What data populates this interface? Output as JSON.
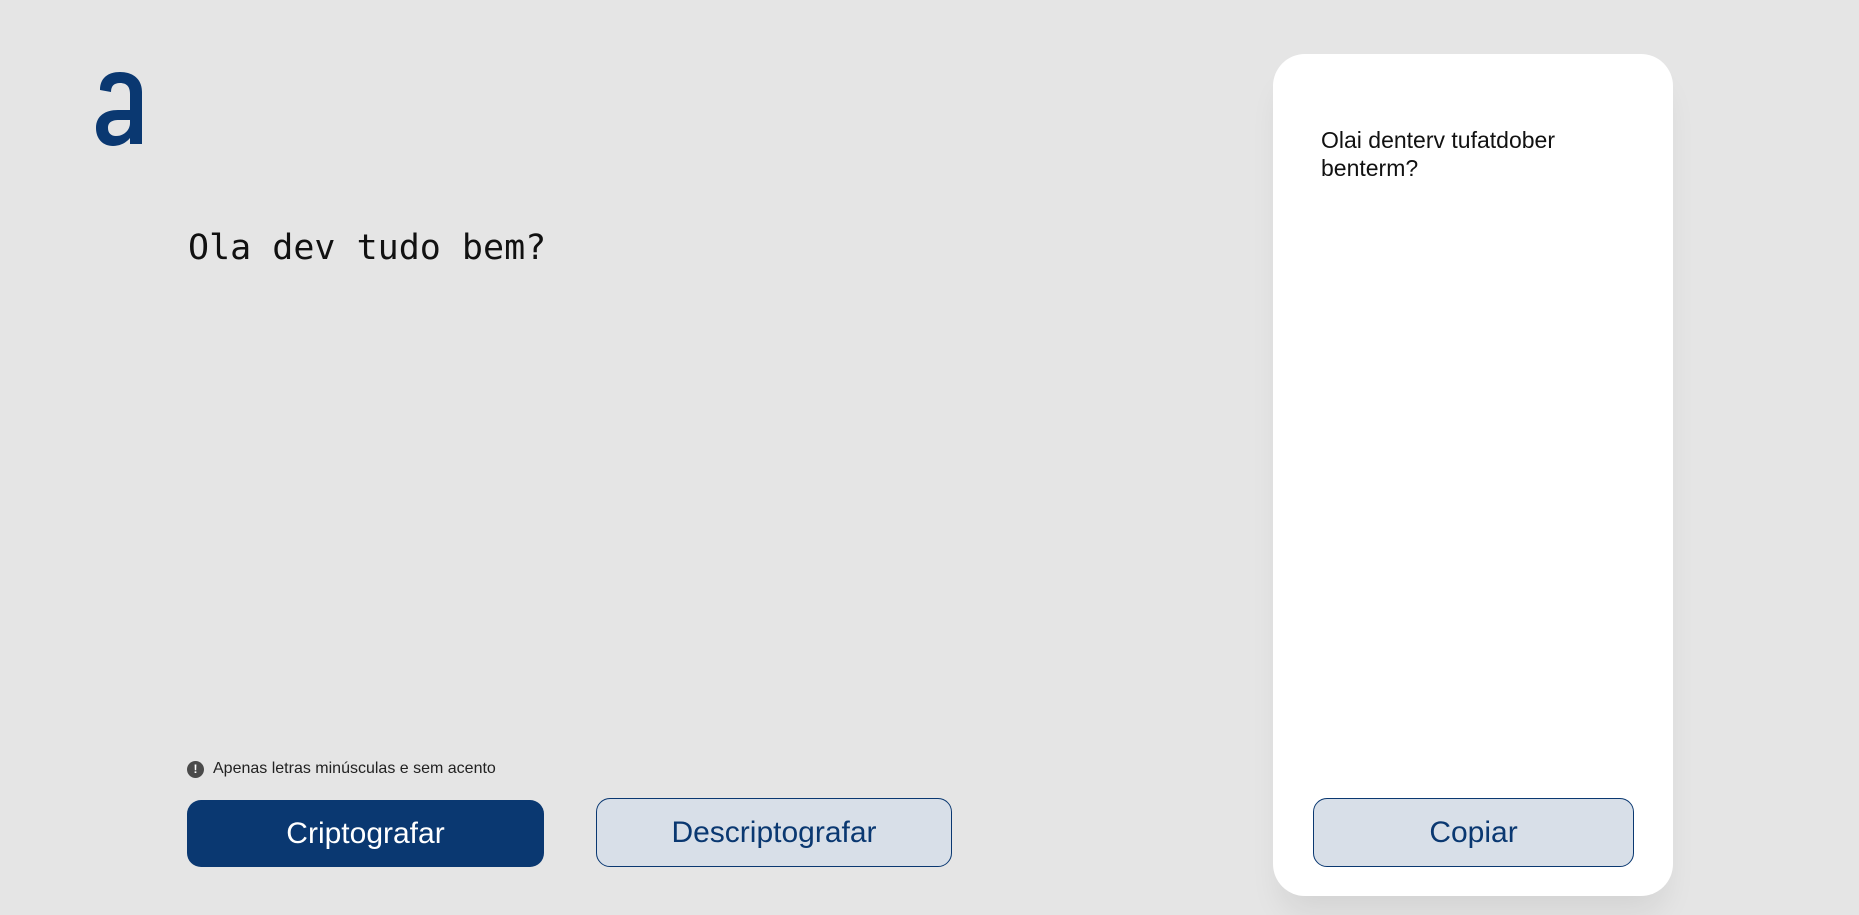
{
  "brand": {
    "logo_name": "alura-logo",
    "color": "#0a3871"
  },
  "input": {
    "value": "Ola dev tudo bem?"
  },
  "hint": {
    "icon": "exclamation-circle-icon",
    "text": "Apenas letras minúsculas e sem acento"
  },
  "actions": {
    "encrypt_label": "Criptografar",
    "decrypt_label": "Descriptografar"
  },
  "output": {
    "text": "Olai denterv tufatdober benterm?",
    "copy_label": "Copiar"
  }
}
